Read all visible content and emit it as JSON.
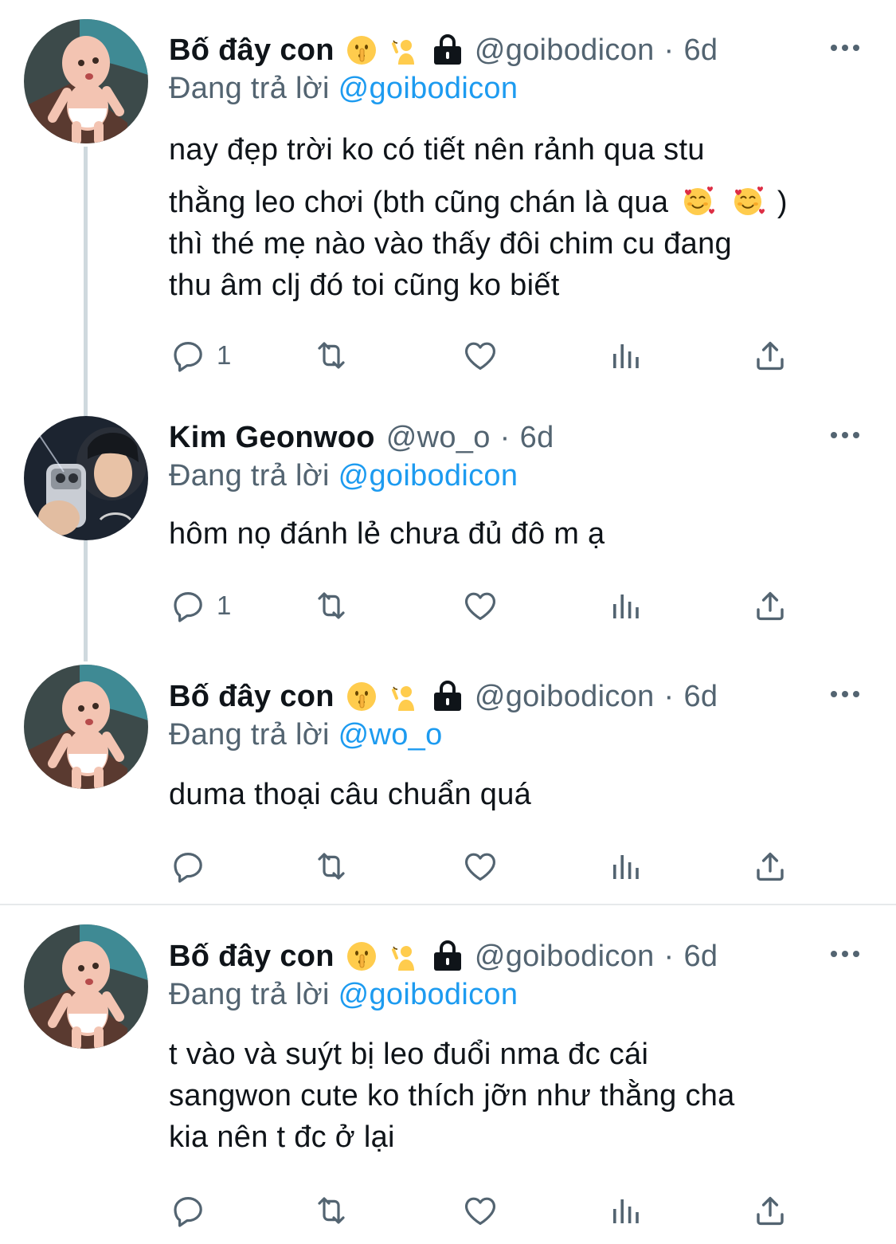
{
  "tweets": [
    {
      "name": "Bố đây con",
      "handle": "@goibodicon",
      "sep": "·",
      "time": "6d",
      "replying_prefix": "Đang trả lời",
      "replying_to": "@goibodicon",
      "lines": [
        "nay đẹp trời ko có tiết nên rảnh qua stu",
        "thằng leo chơi (bth cũng chán là qua",
        "thì thé mẹ nào vào thấy đôi chim cu đang",
        "thu âm clj đó toi cũng ko biết"
      ],
      "line2_tail": ")",
      "reply_count": "1"
    },
    {
      "name": "Kim Geonwoo",
      "handle": "@wo_o",
      "sep": "·",
      "time": "6d",
      "replying_prefix": "Đang trả lời",
      "replying_to": "@goibodicon",
      "lines": [
        "hôm nọ đánh lẻ chưa đủ đô m ạ"
      ],
      "reply_count": "1"
    },
    {
      "name": "Bố đây con",
      "handle": "@goibodicon",
      "sep": "·",
      "time": "6d",
      "replying_prefix": "Đang trả lời",
      "replying_to": "@wo_o",
      "lines": [
        "duma thoại câu chuẩn quá"
      ],
      "reply_count": ""
    },
    {
      "name": "Bố đây con",
      "handle": "@goibodicon",
      "sep": "·",
      "time": "6d",
      "replying_prefix": "Đang trả lời",
      "replying_to": "@goibodicon",
      "lines": [
        "t vào và suýt bị leo đuổi nma đc cái",
        "sangwon cute ko thích jỡn như thằng cha",
        "kia nên t đc ở lại"
      ],
      "reply_count": ""
    }
  ],
  "icons": [
    "shushing-face-emoji",
    "person-raising-hand-emoji",
    "lock-icon",
    "more-icon",
    "smiling-face-with-hearts-emoji",
    "reply-icon",
    "retweet-icon",
    "like-icon",
    "views-icon",
    "share-icon"
  ],
  "colors": {
    "text": "#0f1419",
    "secondary": "#536471",
    "accent": "#1d9bf0",
    "thread": "#cfd9de"
  }
}
